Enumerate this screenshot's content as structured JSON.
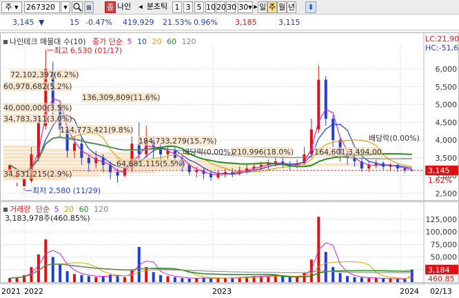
{
  "toolbar": {
    "type_label": "주",
    "code": "267320",
    "name_tag": "종",
    "stock_name": "나인",
    "period_label": "분초틱",
    "intervals": [
      "1",
      "3",
      "5",
      "10",
      "20",
      "30"
    ],
    "interval_selected": "30",
    "period_day": "일",
    "period_week": "주",
    "period_month": "월",
    "period_year": "년"
  },
  "quote": {
    "price": "3,145",
    "change": "15",
    "change_pct": "-0.47%",
    "volume": "419,929",
    "turnover_pct": "21.53%",
    "ratio_pct": "0.96%",
    "high": "3,185",
    "low": "3,115"
  },
  "price_chart": {
    "legend_title": "나인테크 매물대 수(10)",
    "legend_ma_label": "종가 단순",
    "legend_ma_periods": [
      "5",
      "10",
      "20",
      "60",
      "120"
    ],
    "legend_ma_colors": [
      "#d020d0",
      "#1f3fd0",
      "#e8a000",
      "#209020",
      "#808080"
    ],
    "corner_lc": "LC:21,90",
    "corner_hc": "HC:-51,6",
    "y_ticks": [
      "6,000",
      "5,500",
      "5,000",
      "4,500",
      "4,000",
      "3,500",
      "3,000",
      "2,500"
    ],
    "current_price_tag": "3,145",
    "current_pct_tag": "1.62%",
    "annotations": {
      "high": "최고 6,530 (01/17)",
      "low": "최저 2,580 (11/29)",
      "vp1": "72,102,397(6.2%)",
      "vp2": "60,978,682(5.2%)",
      "vp3": "136,309,809(11.6%)",
      "vp4": "40,000,000(3.5%)",
      "vp5": "34,783,311(3.0%)",
      "vp6": "114,773,421(9.8%)",
      "vp7": "184,733,279(15.7%)",
      "vp8": "64,681,115(5.5%)",
      "vp9": "210,996(18.0%)",
      "vp10": "164,601,3,494,00",
      "vp11": "34,531,215(2.9%)",
      "div1": "배당락(0.00%)",
      "div2": "배당락(0.00%)"
    }
  },
  "volume_chart": {
    "legend_title": "거래량",
    "legend_ma_label": "단순",
    "legend_ma_periods": [
      "5",
      "20",
      "60",
      "120"
    ],
    "legend_ma_colors": [
      "#d020d0",
      "#e8a000",
      "#209020",
      "#808080"
    ],
    "legend_value": "3,183,978주(460.85%)",
    "y_ticks": [
      "125,000",
      "100,000",
      "75,000",
      "50,000",
      "25,000"
    ],
    "current_volume_tag": "3,184",
    "current_pct_tag": "460.85"
  },
  "x_axis": {
    "labels": [
      "2021",
      "2022",
      "2023",
      "2024"
    ],
    "end_date": "02/13"
  },
  "chart_data": {
    "type": "candlestick",
    "y_range": [
      2350,
      6700
    ],
    "candles": [
      [
        3100,
        3300,
        3000,
        2950
      ],
      [
        2950,
        3050,
        2800,
        2700
      ],
      [
        2700,
        2900,
        2650,
        2580
      ],
      [
        2850,
        3600,
        2800,
        3800
      ],
      [
        3500,
        4500,
        3400,
        4700
      ],
      [
        4400,
        6000,
        4300,
        6530
      ],
      [
        5900,
        5000,
        4700,
        6200
      ],
      [
        5000,
        4300,
        4100,
        5100
      ],
      [
        4300,
        3700,
        3500,
        4400
      ],
      [
        3700,
        3900,
        3500,
        4100
      ],
      [
        3900,
        3500,
        3300,
        4100
      ],
      [
        3500,
        3350,
        3100,
        3600
      ],
      [
        3350,
        3500,
        3200,
        3700
      ],
      [
        3500,
        3300,
        3100,
        3600
      ],
      [
        3300,
        3100,
        2900,
        3400
      ],
      [
        3100,
        3000,
        2800,
        3200
      ],
      [
        3000,
        3200,
        2950,
        3300
      ],
      [
        3200,
        3900,
        3100,
        4100
      ],
      [
        3900,
        3600,
        3400,
        4500
      ],
      [
        3600,
        4000,
        3500,
        4400
      ],
      [
        4000,
        3800,
        3500,
        4100
      ],
      [
        3800,
        3600,
        3400,
        3900
      ],
      [
        3600,
        3700,
        3450,
        3850
      ],
      [
        3700,
        3500,
        3300,
        3800
      ],
      [
        3500,
        3300,
        3100,
        3550
      ],
      [
        3300,
        3100,
        3000,
        3350
      ],
      [
        3100,
        3150,
        2950,
        3250
      ],
      [
        3150,
        3050,
        2900,
        3200
      ],
      [
        3050,
        2950,
        2850,
        3100
      ],
      [
        2950,
        3050,
        2900,
        3150
      ],
      [
        3050,
        3100,
        2950,
        3200
      ],
      [
        3100,
        3050,
        2950,
        3200
      ],
      [
        3050,
        3150,
        3000,
        3250
      ],
      [
        3150,
        3200,
        3050,
        3300
      ],
      [
        3200,
        3250,
        3100,
        3350
      ],
      [
        3250,
        3300,
        3150,
        3400
      ],
      [
        3300,
        3350,
        3150,
        3450
      ],
      [
        3350,
        3400,
        3250,
        3500
      ],
      [
        3400,
        3300,
        3200,
        3500
      ],
      [
        3300,
        3250,
        3150,
        3400
      ],
      [
        3250,
        3350,
        3200,
        3450
      ],
      [
        3350,
        3600,
        3300,
        3800
      ],
      [
        3600,
        4300,
        3500,
        4600
      ],
      [
        4300,
        5700,
        4200,
        6100
      ],
      [
        5700,
        4600,
        4400,
        5800
      ],
      [
        4600,
        4000,
        3800,
        4700
      ],
      [
        4000,
        3600,
        3400,
        4100
      ],
      [
        3600,
        3500,
        3300,
        3700
      ],
      [
        3500,
        3400,
        3250,
        3600
      ],
      [
        3400,
        3200,
        3100,
        3500
      ],
      [
        3200,
        3300,
        3100,
        3400
      ],
      [
        3300,
        3350,
        3200,
        3450
      ],
      [
        3350,
        3250,
        3150,
        3400
      ],
      [
        3250,
        3300,
        3150,
        3350
      ],
      [
        3300,
        3200,
        3100,
        3350
      ],
      [
        3200,
        3150,
        3080,
        3250
      ],
      [
        3150,
        3145,
        3115,
        3185
      ]
    ],
    "volumes": [
      8,
      10,
      14,
      30,
      55,
      85,
      50,
      35,
      22,
      16,
      14,
      12,
      10,
      12,
      15,
      12,
      10,
      25,
      70,
      30,
      20,
      14,
      12,
      10,
      8,
      7,
      8,
      9,
      7,
      8,
      9,
      9,
      10,
      11,
      12,
      12,
      13,
      14,
      12,
      10,
      11,
      18,
      45,
      130,
      60,
      30,
      18,
      12,
      10,
      9,
      8,
      8,
      7,
      7,
      6,
      6,
      25
    ]
  }
}
